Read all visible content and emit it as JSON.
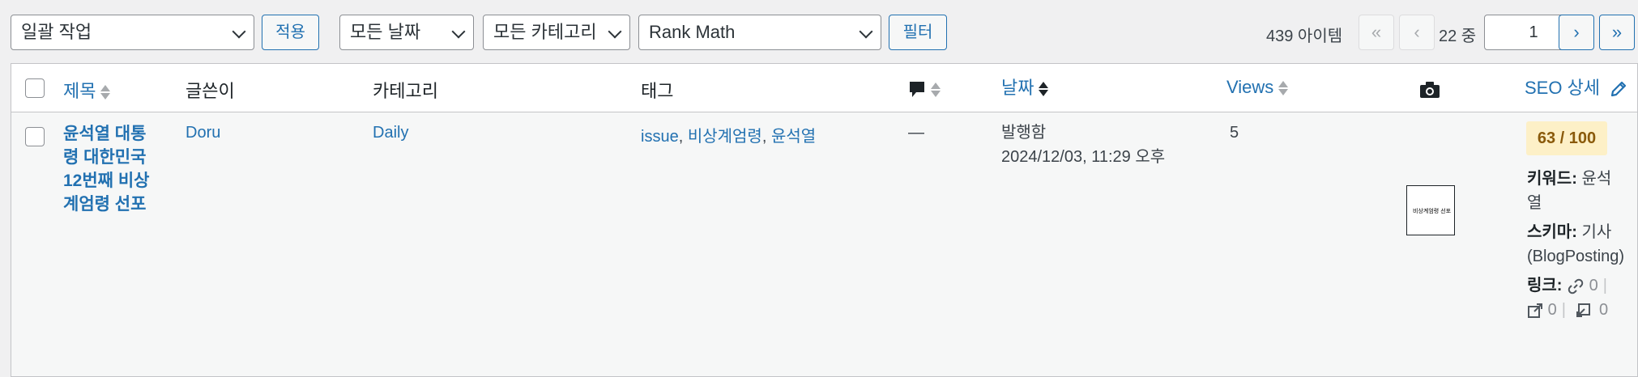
{
  "toolbar": {
    "bulk_action": "일괄 작업",
    "apply": "적용",
    "date_filter": "모든 날짜",
    "category_filter": "모든 카테고리",
    "seo_filter": "Rank Math",
    "filter": "필터"
  },
  "pagination": {
    "item_count": "439 아이템",
    "first": "«",
    "prev": "‹",
    "total_pages": "22 중",
    "current_page": "1",
    "next": "›",
    "last": "»"
  },
  "columns": {
    "title": "제목",
    "author": "글쓴이",
    "categories": "카테고리",
    "tags": "태그",
    "date": "날짜",
    "views": "Views",
    "seo": "SEO 상세"
  },
  "row": {
    "title_lines": [
      "윤석열 대통",
      "령 대한민국",
      "12번째 비상",
      "계엄령 선포"
    ],
    "author": "Doru",
    "category": "Daily",
    "tags": [
      "issue",
      "비상계엄령",
      "윤석열"
    ],
    "tag_sep": ", ",
    "comments": "—",
    "date_status": "발행함",
    "date_value": "2024/12/03, 11:29 오후",
    "views": "5",
    "thumbnail_text": "비상계엄령 선포",
    "seo_score": "63 / 100",
    "keyword_label": "키워드:",
    "keyword_value_1": "윤석",
    "keyword_value_2": "열",
    "schema_label": "스키마:",
    "schema_value_1": "기사",
    "schema_value_2": "(BlogPosting)",
    "links_label": "링크:",
    "internal_links": "0",
    "external_links": "0",
    "incoming_links": "0"
  },
  "colors": {
    "link": "#2271b1",
    "score_bg": "#fdf0c7",
    "score_text": "#8a5a0b"
  }
}
